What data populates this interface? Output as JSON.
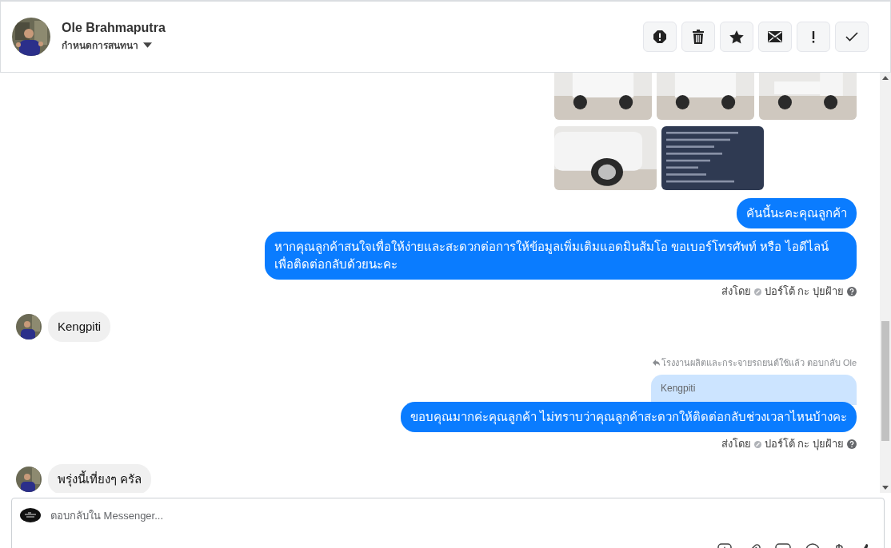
{
  "header": {
    "name": "Ole Brahmaputra",
    "subtitle": "กำหนดการสนทนา",
    "actions": [
      {
        "kind": "alert"
      },
      {
        "kind": "trash"
      },
      {
        "kind": "star"
      },
      {
        "kind": "mail"
      },
      {
        "kind": "exclaim"
      },
      {
        "kind": "check"
      }
    ]
  },
  "messages": [
    {
      "kind": "images"
    },
    {
      "kind": "out",
      "text": "คันนี้นะคะคุณลูกค้า"
    },
    {
      "kind": "out",
      "text": "หากคุณลูกค้าสนใจเพื่อให้ง่ายและสะดวกต่อการให้ข้อมูลเพิ่มเติมแอดมินส้มโอ ขอเบอร์โทรศัพท์ หรือ ไอดีไลน์ เพื่อติดต่อกลับด้วยนะคะ"
    },
    {
      "kind": "sent_by",
      "label": "ส่งโดย",
      "sender": "ปอร์โต้ กะ ปุยฝ้าย"
    },
    {
      "kind": "in",
      "text": "Kengpiti"
    },
    {
      "kind": "reply_header",
      "text": "โรงงานผลิตและกระจายรถยนต์ใช้แล้ว ตอบกลับ Ole"
    },
    {
      "kind": "quoted",
      "text": "Kengpiti"
    },
    {
      "kind": "out",
      "text": "ขอบคุณมากค่ะคุณลูกค้า ไม่ทราบว่าคุณลูกค้าสะดวกให้ติดต่อกลับช่วงเวลาไหนบ้างคะ"
    },
    {
      "kind": "sent_by",
      "label": "ส่งโดย",
      "sender": "ปอร์โต้ กะ ปุยฝ้าย"
    },
    {
      "kind": "in",
      "text": "พรุ่งนี้เที่ยงๆ ครัล"
    }
  ],
  "composer": {
    "placeholder": "ตอบกลับใน Messenger..."
  }
}
